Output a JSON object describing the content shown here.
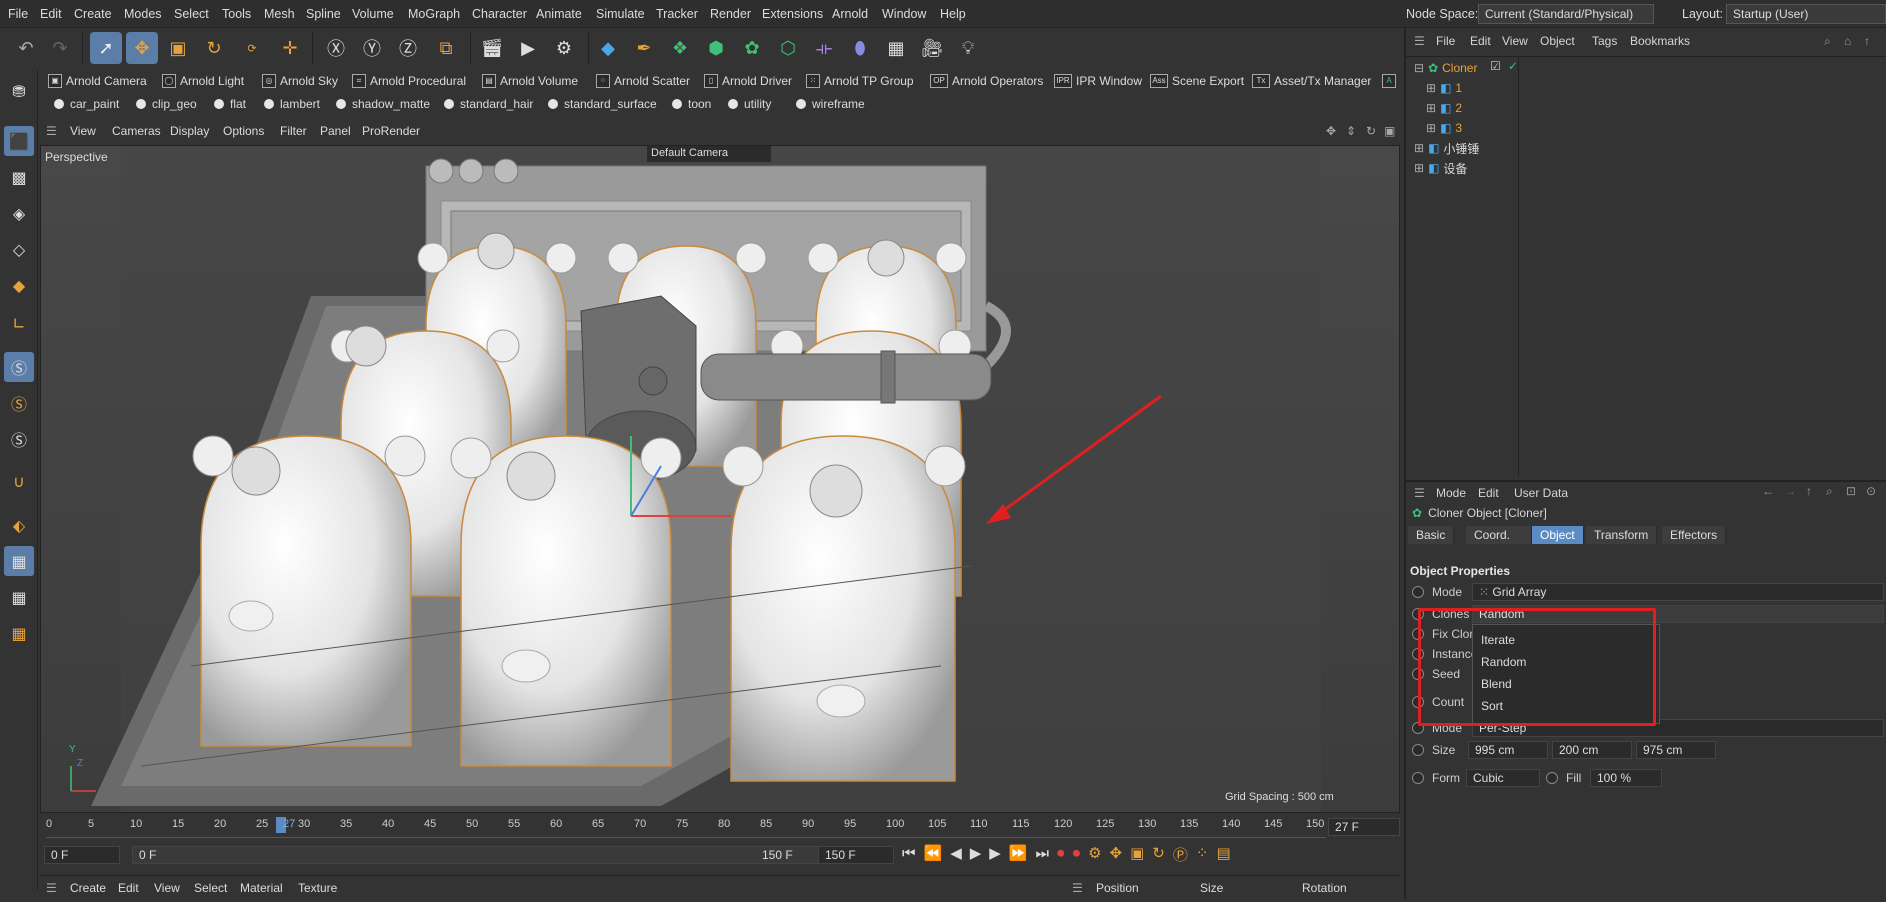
{
  "menubar": {
    "items": [
      "File",
      "Edit",
      "Create",
      "Modes",
      "Select",
      "Tools",
      "Mesh",
      "Spline",
      "Volume",
      "MoGraph",
      "Character",
      "Animate",
      "Simulate",
      "Tracker",
      "Render",
      "Extensions",
      "Arnold",
      "Window",
      "Help"
    ],
    "node_space_label": "Node Space:",
    "node_space_value": "Current (Standard/Physical)",
    "layout_label": "Layout:",
    "layout_value": "Startup (User)"
  },
  "arnold_toolbar": [
    "Arnold Camera",
    "Arnold Light",
    "Arnold Sky",
    "Arnold Procedural",
    "Arnold Volume",
    "Arnold Scatter",
    "Arnold Driver",
    "Arnold TP Group",
    "Arnold Operators",
    "IPR Window",
    "Scene Export",
    "Asset/Tx Manager"
  ],
  "arnold_icons": [
    "OP",
    "IPR",
    "Ass",
    "Tx"
  ],
  "material_bar": [
    "car_paint",
    "clip_geo",
    "flat",
    "lambert",
    "shadow_matte",
    "standard_hair",
    "standard_surface",
    "toon",
    "utility",
    "wireframe"
  ],
  "viewport": {
    "menu": [
      "View",
      "Cameras",
      "Display",
      "Options",
      "Filter",
      "Panel",
      "ProRender"
    ],
    "label": "Perspective",
    "camera": "Default Camera",
    "grid_spacing": "Grid Spacing : 500 cm",
    "axis_y": "Y",
    "axis_z": "Z"
  },
  "timeline": {
    "ticks": [
      "0",
      "5",
      "10",
      "15",
      "20",
      "25",
      "30",
      "35",
      "40",
      "45",
      "50",
      "55",
      "60",
      "65",
      "70",
      "75",
      "80",
      "85",
      "90",
      "95",
      "100",
      "105",
      "110",
      "115",
      "120",
      "125",
      "130",
      "135",
      "140",
      "145",
      "150"
    ],
    "current_frame": "27",
    "frame_field": "27 F",
    "start": "0 F",
    "range_start": "0 F",
    "range_end": "150 F",
    "end": "150 F"
  },
  "bottom": {
    "items": [
      "Create",
      "Edit",
      "View",
      "Select",
      "Material",
      "Texture"
    ],
    "coord_headers": [
      "Position",
      "Size",
      "Rotation"
    ]
  },
  "object_manager": {
    "menu": [
      "File",
      "Edit",
      "View",
      "Object",
      "Tags",
      "Bookmarks"
    ],
    "objects": [
      "Cloner",
      "1",
      "2",
      "3",
      "小锤锤",
      "设备"
    ]
  },
  "attributes": {
    "menu": [
      "Mode",
      "Edit",
      "User Data"
    ],
    "title": "Cloner Object [Cloner]",
    "tabs": [
      "Basic",
      "Coord.",
      "Object",
      "Transform",
      "Effectors"
    ],
    "section": "Object Properties",
    "mode_label": "Mode",
    "mode_value": "Grid Array",
    "clones_label": "Clones",
    "clones_value": "Random",
    "fix_label": "Fix Clon",
    "instance_label": "Instance",
    "seed_label": "Seed",
    "count_label": "Count",
    "dropdown": [
      "Iterate",
      "Random",
      "Blend",
      "Sort"
    ],
    "mode2_label": "Mode",
    "mode2_value": "Per-Step",
    "size_label": "Size",
    "size_x": "995 cm",
    "size_y": "200 cm",
    "size_z": "975 cm",
    "form_label": "Form",
    "form_value": "Cubic",
    "fill_label": "Fill",
    "fill_value": "100 %"
  }
}
